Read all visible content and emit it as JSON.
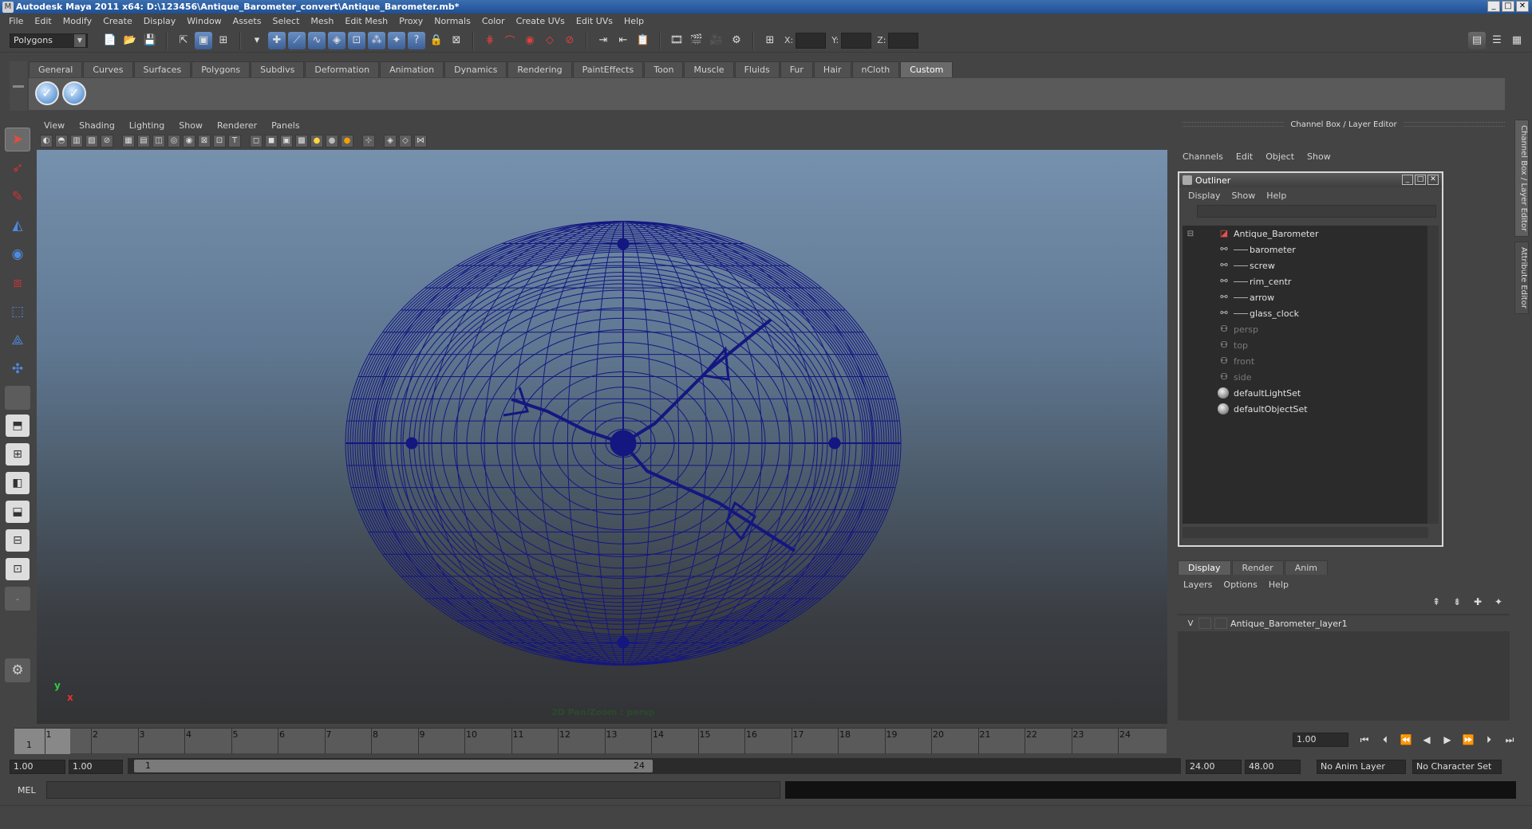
{
  "window": {
    "title": "Autodesk Maya 2011 x64: D:\\123456\\Antique_Barometer_convert\\Antique_Barometer.mb*",
    "controls": [
      "_",
      "□",
      "✕"
    ]
  },
  "menu": [
    "File",
    "Edit",
    "Modify",
    "Create",
    "Display",
    "Window",
    "Assets",
    "Select",
    "Mesh",
    "Edit Mesh",
    "Proxy",
    "Normals",
    "Color",
    "Create UVs",
    "Edit UVs",
    "Help"
  ],
  "statusline": {
    "mode": "Polygons",
    "x_label": "X:",
    "y_label": "Y:",
    "z_label": "Z:"
  },
  "shelf": {
    "tabs": [
      "General",
      "Curves",
      "Surfaces",
      "Polygons",
      "Subdivs",
      "Deformation",
      "Animation",
      "Dynamics",
      "Rendering",
      "PaintEffects",
      "Toon",
      "Muscle",
      "Fluids",
      "Fur",
      "Hair",
      "nCloth",
      "Custom"
    ],
    "active_tab": "Custom"
  },
  "viewport": {
    "menu": [
      "View",
      "Shading",
      "Lighting",
      "Show",
      "Renderer",
      "Panels"
    ],
    "hud": "2D Pan/Zoom : persp",
    "axis_y": "y",
    "axis_x": "x",
    "wire_color": "#141780"
  },
  "channel_box": {
    "header": "Channel Box / Layer Editor",
    "menu": [
      "Channels",
      "Edit",
      "Object",
      "Show"
    ]
  },
  "outliner": {
    "title": "Outliner",
    "menu": [
      "Display",
      "Show",
      "Help"
    ],
    "root": "Antique_Barometer",
    "children": [
      "barometer",
      "screw",
      "rim_centr",
      "arrow",
      "glass_clock"
    ],
    "cameras": [
      "persp",
      "top",
      "front",
      "side"
    ],
    "sets": [
      "defaultLightSet",
      "defaultObjectSet"
    ]
  },
  "layer_editor": {
    "tabs": [
      "Display",
      "Render",
      "Anim"
    ],
    "active_tab": "Display",
    "menu": [
      "Layers",
      "Options",
      "Help"
    ],
    "layer_visibility": "V",
    "layer_name": "Antique_Barometer_layer1"
  },
  "side_tabs": [
    "Channel Box / Layer Editor",
    "Attribute Editor"
  ],
  "timeslider": {
    "current_frame": "1",
    "ticks": [
      "1",
      "2",
      "3",
      "4",
      "5",
      "6",
      "7",
      "8",
      "9",
      "10",
      "11",
      "12",
      "13",
      "14",
      "15",
      "16",
      "17",
      "18",
      "19",
      "20",
      "21",
      "22",
      "23",
      "24"
    ],
    "frame_field": "1.00"
  },
  "range": {
    "start": "1.00",
    "playback_start": "1.00",
    "thumb_start": "1",
    "thumb_end": "24",
    "playback_end": "24.00",
    "end": "48.00",
    "anim_layer": "No Anim Layer",
    "character_set": "No Character Set"
  },
  "commandline": {
    "label": "MEL"
  }
}
